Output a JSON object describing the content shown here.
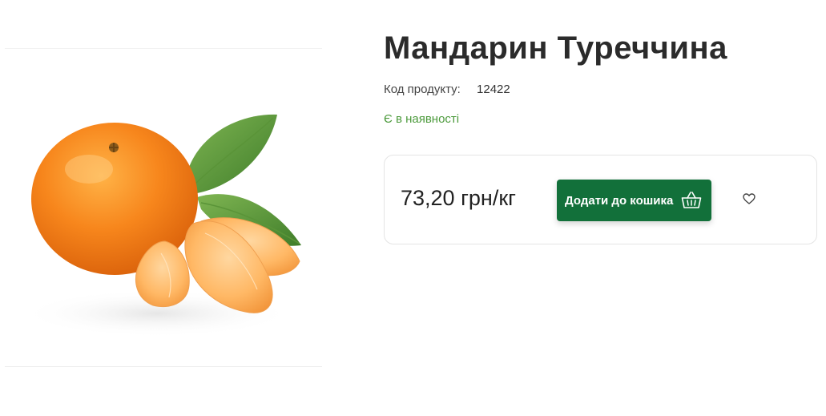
{
  "product": {
    "image_alt": "Mandarin",
    "title": "Мандарин Туреччина",
    "code_label": "Код продукту:",
    "code_value": "12422",
    "stock_status": "Є в наявності"
  },
  "purchase": {
    "price": "73,20 грн/кг",
    "add_to_cart_label": "Додати до кошика",
    "cart_icon": "basket-icon",
    "wishlist_icon": "heart-icon"
  },
  "colors": {
    "button_bg": "#12703a",
    "stock_green": "#4c9a3c",
    "title": "#2b2b2b"
  }
}
